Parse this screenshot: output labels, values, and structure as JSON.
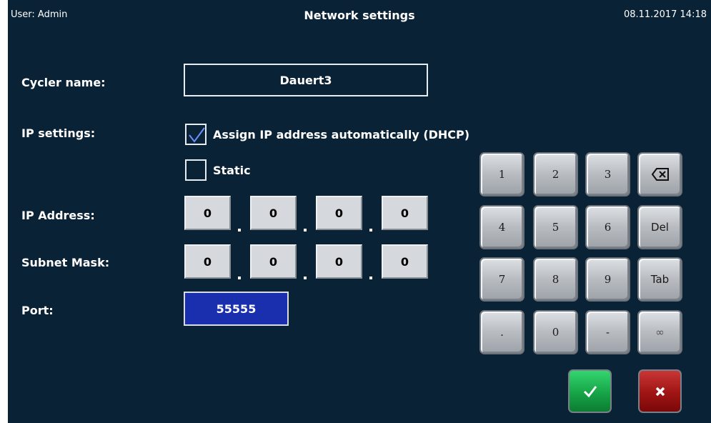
{
  "header": {
    "user": "User: Admin",
    "title": "Network settings",
    "datetime": "08.11.2017 14:18"
  },
  "form": {
    "cycler_name_label": "Cycler name:",
    "cycler_name_value": "Dauert3",
    "ip_settings_label": "IP settings:",
    "dhcp_label": "Assign IP address automatically (DHCP)",
    "dhcp_checked": true,
    "static_label": "Static",
    "static_checked": false,
    "ip_address_label": "IP Address:",
    "ip_octets": [
      "0",
      "0",
      "0",
      "0"
    ],
    "subnet_label": "Subnet Mask:",
    "subnet_octets": [
      "0",
      "0",
      "0",
      "0"
    ],
    "port_label": "Port:",
    "port_value": "55555"
  },
  "keypad": {
    "keys": [
      "1",
      "2",
      "3",
      "backspace",
      "4",
      "5",
      "6",
      "Del",
      "7",
      "8",
      "9",
      "Tab",
      ".",
      "0",
      "-",
      "∞"
    ],
    "ok_icon": "checkmark-icon",
    "cancel_icon": "x-icon"
  },
  "colors": {
    "background": "#0a2236",
    "port_field": "#1a2fae",
    "ok_button": "#16a447",
    "cancel_button": "#a01414"
  }
}
